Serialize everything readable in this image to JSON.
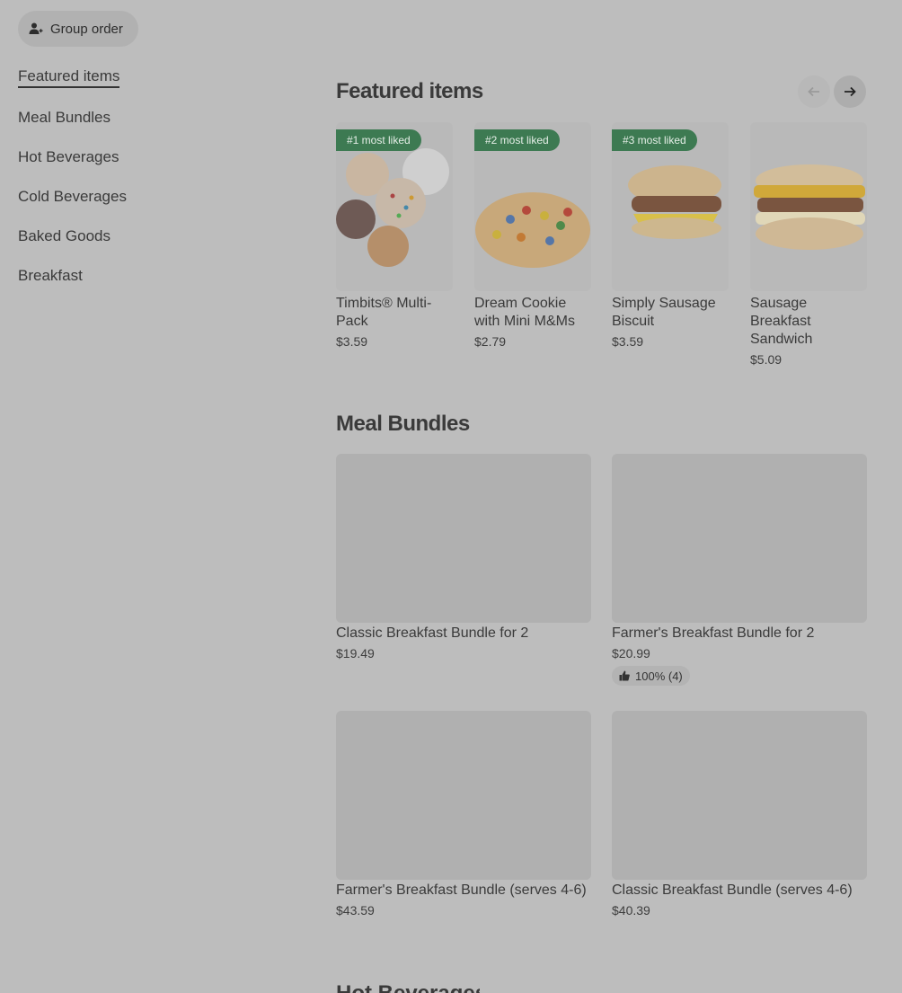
{
  "group_order": {
    "label": "Group order",
    "icon": "person-add-icon"
  },
  "sidebar": {
    "items": [
      {
        "label": "Featured items"
      },
      {
        "label": "Meal Bundles"
      },
      {
        "label": "Hot Beverages"
      },
      {
        "label": "Cold Beverages"
      },
      {
        "label": "Baked Goods"
      },
      {
        "label": "Breakfast"
      }
    ]
  },
  "featured": {
    "title": "Featured items",
    "items": [
      {
        "badge": "#1 most liked",
        "name": "Timbits® Multi-Pack",
        "price": "$3.59"
      },
      {
        "badge": "#2 most liked",
        "name": "Dream Cookie with Mini M&Ms",
        "price": "$2.79"
      },
      {
        "badge": "#3 most liked",
        "name": "Simply Sausage Biscuit",
        "price": "$3.59"
      },
      {
        "badge": "",
        "name": "Sausage Breakfast Sandwich",
        "price": "$5.09"
      }
    ]
  },
  "bundles": {
    "title": "Meal Bundles",
    "items": [
      {
        "name": "Classic Breakfast Bundle for 2",
        "price": "$19.49"
      },
      {
        "name": "Farmer's Breakfast Bundle for 2",
        "price": "$20.99",
        "rating": "100% (4)"
      },
      {
        "name": "Farmer's Breakfast Bundle (serves 4-6)",
        "price": "$43.59"
      },
      {
        "name": "Classic Breakfast Bundle (serves 4-6)",
        "price": "$40.39"
      }
    ]
  },
  "next_section": {
    "title": "Hot Beverages"
  },
  "colors": {
    "badge_green": "#3d7a52",
    "overlay_gray": "#bdbdbd"
  }
}
